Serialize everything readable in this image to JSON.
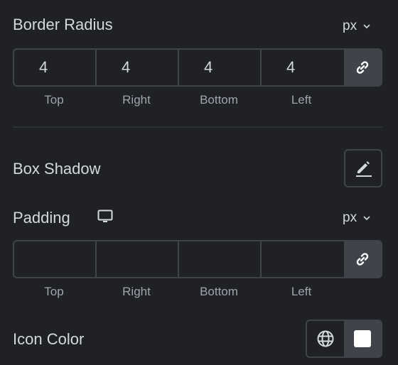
{
  "border_radius": {
    "label": "Border Radius",
    "unit": "px",
    "values": {
      "top": "4",
      "right": "4",
      "bottom": "4",
      "left": "4"
    },
    "sides": [
      "Top",
      "Right",
      "Bottom",
      "Left"
    ],
    "linked": true
  },
  "box_shadow": {
    "label": "Box Shadow"
  },
  "padding": {
    "label": "Padding",
    "device_icon": "desktop-icon",
    "unit": "px",
    "values": {
      "top": "",
      "right": "",
      "bottom": "",
      "left": ""
    },
    "sides": [
      "Top",
      "Right",
      "Bottom",
      "Left"
    ],
    "linked": true
  },
  "icon_color": {
    "label": "Icon Color",
    "value": "#ffffff"
  },
  "colors": {
    "background": "#1f2124",
    "border": "#3f444b",
    "text": "#d5d8dc",
    "muted": "#9da5ae"
  }
}
